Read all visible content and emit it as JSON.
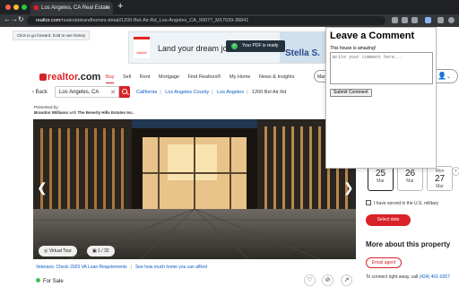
{
  "browser": {
    "tab_title": "Los Angeles, CA Real Estate",
    "url_prefix": "realtor.com",
    "url_rest": "/realestateandhomes-detail/1200-Bel-Air-Rd_Los-Angeles_CA_90077_M17639-38841",
    "tooltip": "Click to go forward, hold to see history"
  },
  "ad": {
    "brand": "Adobe",
    "headline": "Land your dream job.",
    "right_text": "Stella S.",
    "toast": "Your PDF is ready"
  },
  "header": {
    "logo_main": "realtor",
    "logo_suffix": ".com",
    "nav": [
      "Buy",
      "Sell",
      "Rent",
      "Mortgage",
      "Find Realtors®",
      "My Home",
      "News & Insights"
    ],
    "active_nav": "Buy",
    "manage_label": "Man"
  },
  "search": {
    "back_label": "Back",
    "value": "Los Angeles, CA"
  },
  "breadcrumbs": [
    "California",
    "Los Angeles County",
    "Los Angeles",
    "1200 Bel Air Rd"
  ],
  "presented": {
    "line1": "Presented by:",
    "agent": "Brandon Williams",
    "with": "with",
    "brokerage": "The Beverly Hills Estates Inc."
  },
  "photo": {
    "virtual_tour": "Virtual Tour",
    "count": "1 / 32"
  },
  "links": {
    "veterans": "Veterans: Check 2023 VA Loan Requirements",
    "see_how": "See how much home you can afford"
  },
  "status": "For Sale",
  "tour_dates": [
    {
      "dow": "",
      "day": "25",
      "mon": "Mar"
    },
    {
      "dow": "",
      "day": "26",
      "mon": "Mar"
    },
    {
      "dow": "Mon",
      "day": "27",
      "mon": "Mar"
    }
  ],
  "sidebar": {
    "military": "I have served in the U.S. military",
    "select_date": "Select date",
    "more_about": "More about this property",
    "email_agent": "Email agent",
    "connect_text": "To connect right away, call",
    "phone": "(424) 401-0267"
  },
  "comment_popup": {
    "title": "Leave a Comment",
    "note": "This house is amazing!",
    "placeholder": "Write your comment here...",
    "submit": "Submit Comment"
  },
  "colors": {
    "brand_red": "#d92228",
    "link_blue": "#0a5cc1"
  }
}
